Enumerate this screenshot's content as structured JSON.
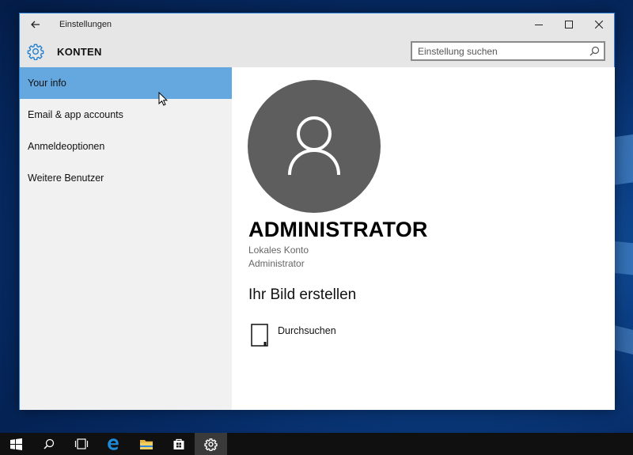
{
  "window": {
    "title": "Einstellungen"
  },
  "header": {
    "title": "KONTEN",
    "search_placeholder": "Einstellung suchen"
  },
  "sidebar": {
    "items": [
      {
        "label": "Your info",
        "active": true
      },
      {
        "label": "Email & app accounts",
        "active": false
      },
      {
        "label": "Anmeldeoptionen",
        "active": false
      },
      {
        "label": "Weitere Benutzer",
        "active": false
      }
    ]
  },
  "content": {
    "user_name": "ADMINISTRATOR",
    "account_type": "Lokales Konto",
    "account_role": "Administrator",
    "section_title": "Ihr Bild erstellen",
    "browse_label": "Durchsuchen"
  },
  "taskbar": {
    "items": [
      "windows-start-icon",
      "search-icon",
      "task-view-icon",
      "edge-icon",
      "file-explorer-icon",
      "store-icon",
      "settings-icon"
    ],
    "active": "settings-icon"
  },
  "colors": {
    "accent": "#65a8e0",
    "accent_icon": "#1e7fd1",
    "avatar_bg": "#5e5e5e",
    "sidebar_bg": "#f1f1f1",
    "titlebar_bg": "#e6e6e6"
  }
}
